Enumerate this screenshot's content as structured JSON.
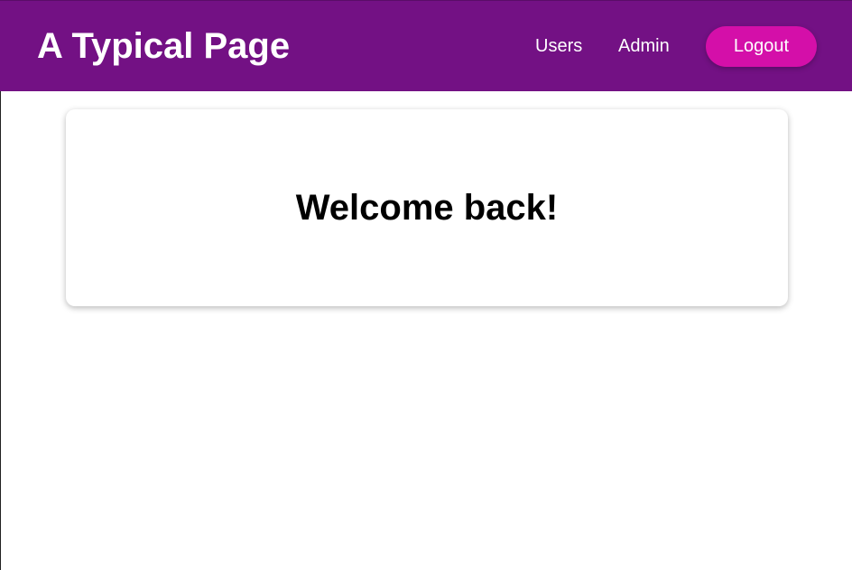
{
  "header": {
    "title": "A Typical Page",
    "nav": {
      "users": "Users",
      "admin": "Admin",
      "logout": "Logout"
    }
  },
  "main": {
    "welcome": "Welcome back!"
  },
  "colors": {
    "header_background": "#731184",
    "logout_button": "#d40fa9",
    "text_light": "#ffffff",
    "text_dark": "#000000"
  }
}
